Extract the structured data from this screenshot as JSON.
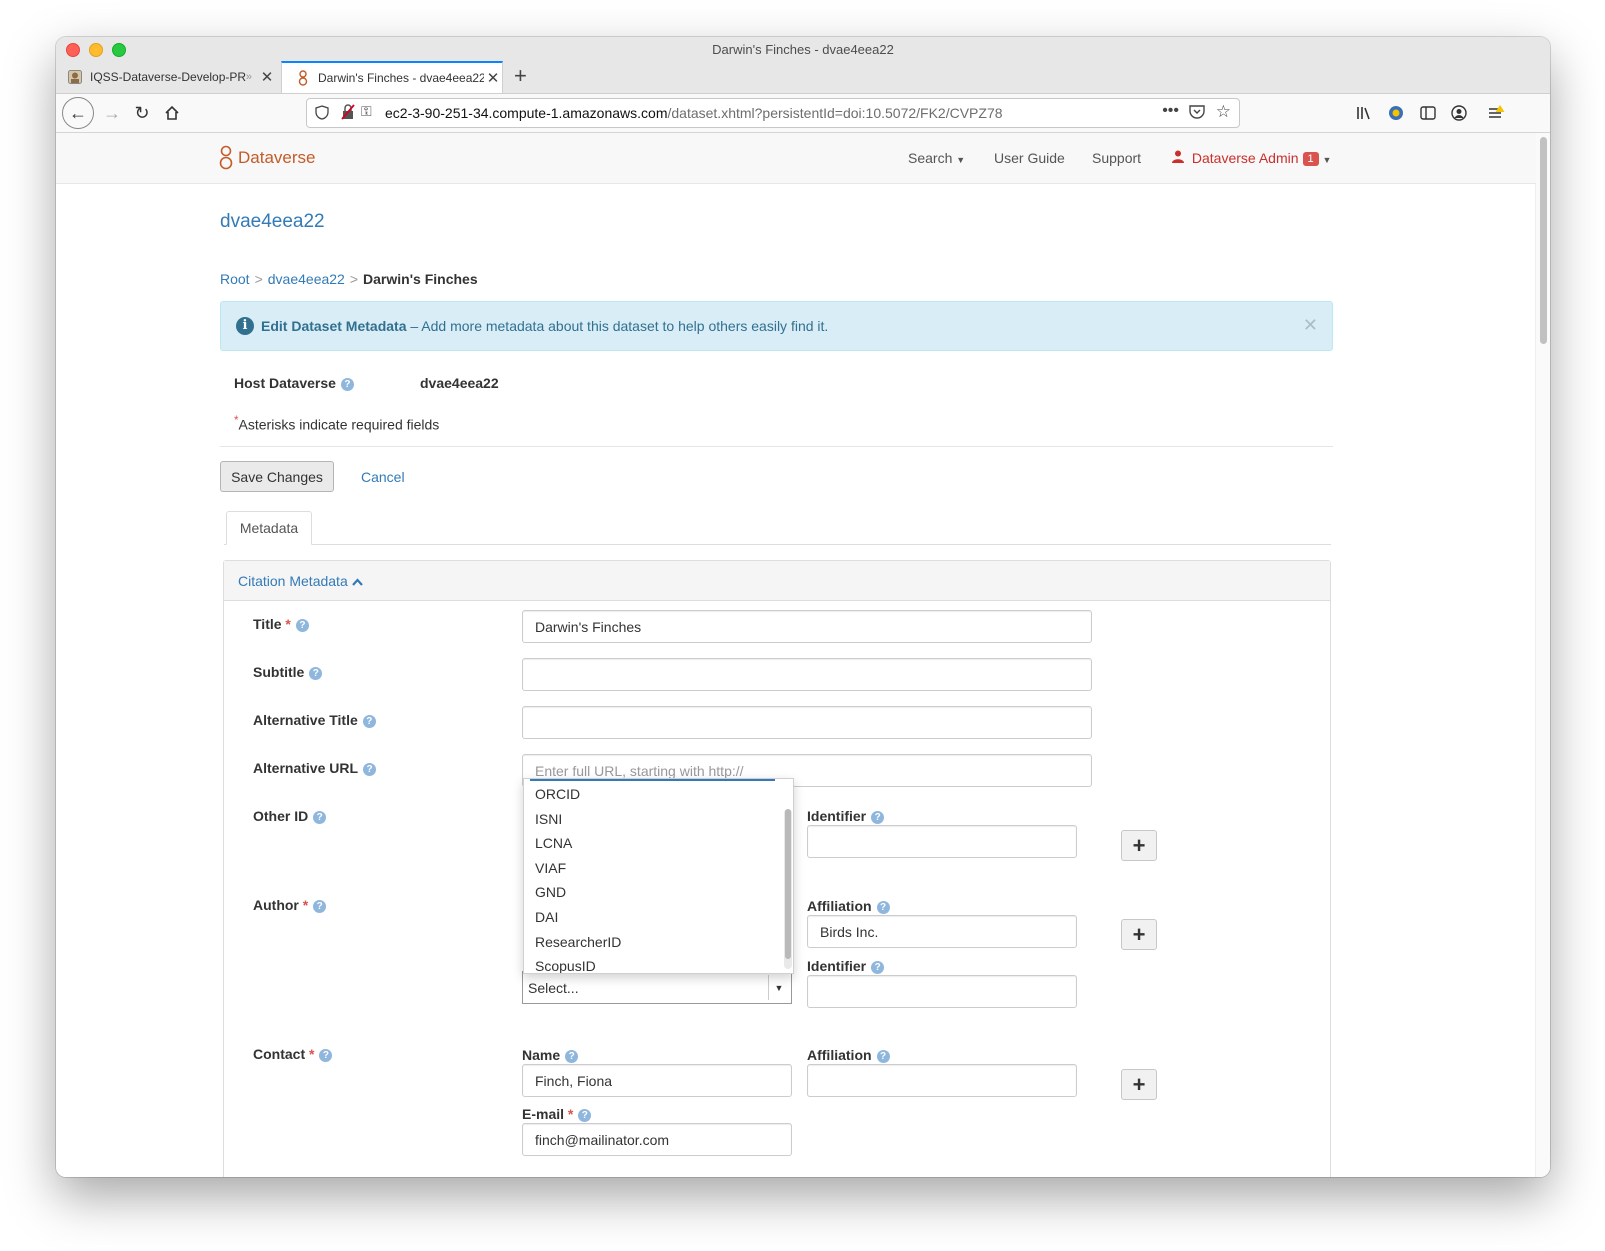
{
  "window": {
    "title": "Darwin's Finches - dvae4eea22"
  },
  "tabs": [
    {
      "label": "IQSS-Dataverse-Develop-PR"
    },
    {
      "label": "Darwin's Finches - dvae4eea22"
    }
  ],
  "browser": {
    "url_host": "ec2-3-90-251-34.compute-1.amazonaws.com",
    "url_path": "/dataset.xhtml?persistentId=doi:10.5072/FK2/CVPZ78"
  },
  "topnav": {
    "brand": "Dataverse",
    "search": "Search",
    "user_guide": "User Guide",
    "support": "Support",
    "user": "Dataverse Admin",
    "notifications": "1"
  },
  "page": {
    "dataverse_name": "dvae4eea22",
    "breadcrumb": {
      "root": "Root",
      "parent": "dvae4eea22",
      "current": "Darwin's Finches"
    },
    "alert": {
      "strong": "Edit Dataset Metadata",
      "text": " – Add more metadata about this dataset to help others easily find it."
    },
    "host_label": "Host Dataverse",
    "host_value": "dvae4eea22",
    "required_note": "Asterisks indicate required fields",
    "save_label": "Save Changes",
    "cancel_label": "Cancel",
    "tab_metadata": "Metadata",
    "panel_title": "Citation Metadata"
  },
  "form": {
    "title": {
      "label": "Title",
      "value": "Darwin's Finches"
    },
    "subtitle": {
      "label": "Subtitle",
      "value": ""
    },
    "alt_title": {
      "label": "Alternative Title",
      "value": ""
    },
    "alt_url": {
      "label": "Alternative URL",
      "placeholder": "Enter full URL, starting with http://"
    },
    "other_id": {
      "label": "Other ID",
      "identifier_label": "Identifier",
      "identifier_value": ""
    },
    "author": {
      "label": "Author",
      "affiliation_label": "Affiliation",
      "affiliation_value": "Birds Inc.",
      "identifier_label": "Identifier",
      "identifier_value": "",
      "scheme_value": "Select..."
    },
    "contact": {
      "label": "Contact",
      "name_label": "Name",
      "name_value": "Finch, Fiona",
      "affiliation_label": "Affiliation",
      "affiliation_value": "",
      "email_label": "E-mail",
      "email_value": "finch@mailinator.com"
    }
  },
  "dropdown_options": [
    "ORCID",
    "ISNI",
    "LCNA",
    "VIAF",
    "GND",
    "DAI",
    "ResearcherID",
    "ScopusID"
  ]
}
